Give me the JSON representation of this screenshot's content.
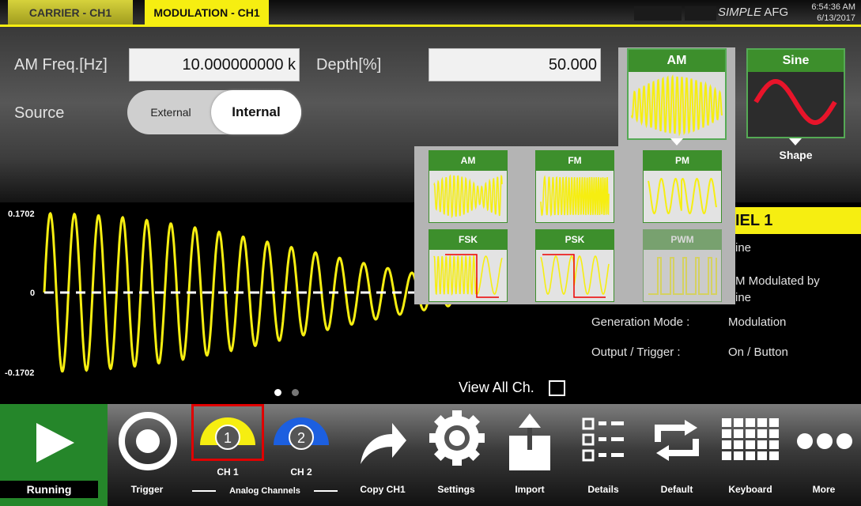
{
  "tabs": {
    "carrier": "CARRIER - CH1",
    "modulation": "MODULATION - CH1"
  },
  "app": {
    "name_italic": "SIMPLE",
    "name_rest": " AFG",
    "time": "6:54:36 AM",
    "date": "6/13/2017"
  },
  "params": {
    "freq_label": "AM Freq.[Hz]",
    "freq_value": "10.000000000 k",
    "depth_label": "Depth[%]",
    "depth_value": "50.000",
    "source_label": "Source",
    "source_external": "External",
    "source_internal": "Internal"
  },
  "type_card": {
    "label": "AM"
  },
  "shape_card": {
    "label": "Sine",
    "caption": "Shape"
  },
  "popup": {
    "items": [
      {
        "label": "AM"
      },
      {
        "label": "FM"
      },
      {
        "label": "PM"
      },
      {
        "label": "FSK"
      },
      {
        "label": "PSK"
      },
      {
        "label": "PWM",
        "disabled": true
      }
    ]
  },
  "plot": {
    "ymax": "0.1702",
    "zero": "0",
    "ymin": "-0.1702",
    "wave_color": "#f6ee11"
  },
  "channel": {
    "header": "IEL 1",
    "rows": [
      {
        "v": "ine"
      },
      {
        "v": "M Modulated by"
      },
      {
        "v": "ine"
      }
    ],
    "gen_label": "Generation Mode :",
    "gen_value": "Modulation",
    "out_label": "Output / Trigger :",
    "out_value": "On / Button"
  },
  "view_all": "View All Ch.",
  "toolbar": {
    "running": "Running",
    "trigger": "Trigger",
    "ch1": "CH 1",
    "ch1_num": "1",
    "ch2": "CH 2",
    "ch2_num": "2",
    "analog": "Analog Channels",
    "copy": "Copy CH1",
    "settings": "Settings",
    "import": "Import",
    "details": "Details",
    "default": "Default",
    "keyboard": "Keyboard",
    "more": "More"
  },
  "colors": {
    "accent": "#f6ee11",
    "green": "#3d8f2c",
    "ch2": "#1c5fe0"
  }
}
